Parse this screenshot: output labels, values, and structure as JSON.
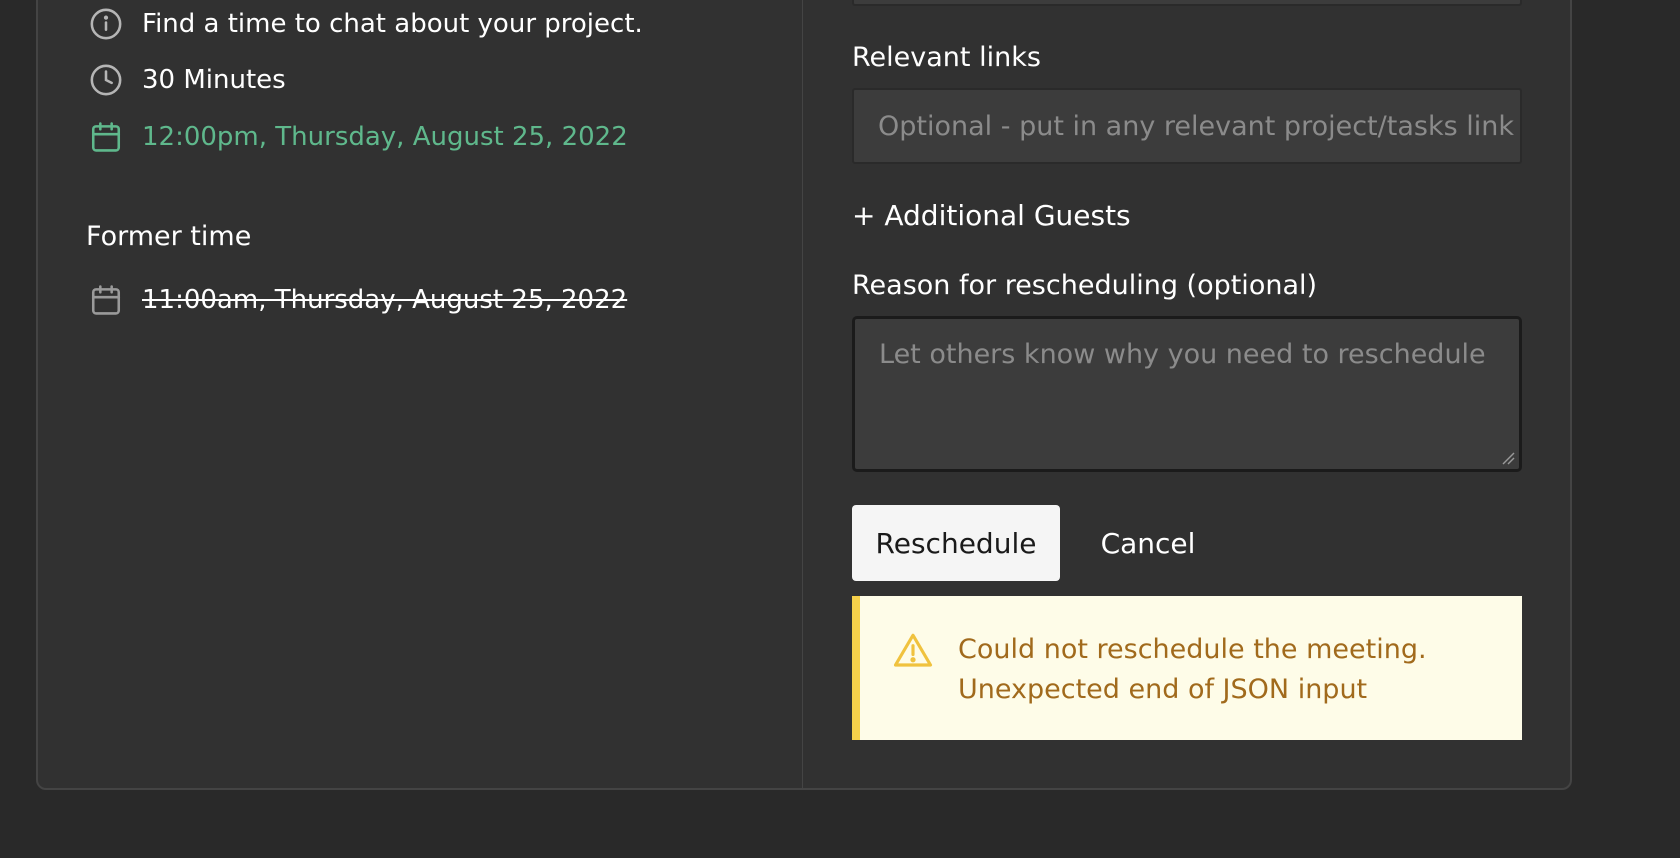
{
  "details": {
    "description": "Find a time to chat about your project.",
    "duration": "30 Minutes",
    "new_time": "12:00pm, Thursday, August 25, 2022",
    "former_time_title": "Former time",
    "former_time": "11:00am, Thursday, August 25, 2022"
  },
  "form": {
    "links_label": "Relevant links",
    "links_placeholder": "Optional - put in any relevant project/tasks link",
    "add_guests": "+ Additional Guests",
    "reason_label": "Reason for rescheduling (optional)",
    "reason_placeholder": "Let others know why you need to reschedule",
    "reschedule_label": "Reschedule",
    "cancel_label": "Cancel"
  },
  "alert": {
    "line1": "Could not reschedule the meeting.",
    "line2": "Unexpected end of JSON input"
  },
  "colors": {
    "accent_green": "#5fb88c",
    "warning_border": "#f5d04a",
    "warning_text": "#a16a1c",
    "warning_bg": "#fefce8"
  }
}
